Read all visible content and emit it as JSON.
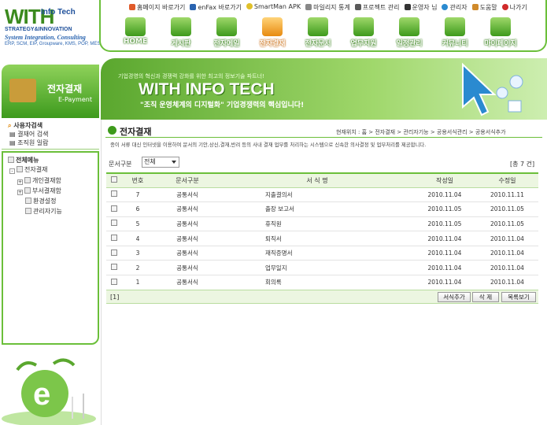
{
  "logo": {
    "line1": "WITH",
    "line2": "Info Tech",
    "line3": "STRATEGY&INNOVATION",
    "line4": "System Integration, Consulting",
    "line5": "ERP, SCM, EIP, Groupware, KMS, POP, MES"
  },
  "top_links": [
    "홈페이지 바로가기",
    "enFax 바로가기",
    "SmartMan APK",
    "마일리지 통계",
    "프로젝트 관리",
    "운영자 님",
    "관리자",
    "도움말",
    "나가기"
  ],
  "nav": [
    {
      "label": "HOME",
      "active": false
    },
    {
      "label": "게시판",
      "active": false
    },
    {
      "label": "전자메일",
      "active": false
    },
    {
      "label": "전자결재",
      "active": true
    },
    {
      "label": "전자문서",
      "active": false
    },
    {
      "label": "업무지원",
      "active": false
    },
    {
      "label": "일정관리",
      "active": false
    },
    {
      "label": "커뮤니티",
      "active": false
    },
    {
      "label": "마이페이지",
      "active": false
    }
  ],
  "banner": {
    "tagline": "기업경영의 혁신과 경쟁력 강화를 위한 최고의 정보기술 파트너!",
    "title": "WITH INFO TECH",
    "slogan": "\"조직 운영체계의 디지털화\" 기업경쟁력의 핵심입니다!"
  },
  "left": {
    "title": "전자결재",
    "subtitle": "E-Payment",
    "search_header": "사용자검색",
    "search_items": [
      "결재어 검색",
      "조직원 일람"
    ],
    "menu_header": "전체메뉴",
    "tree": [
      {
        "label": "전자결재",
        "level": 0,
        "toggle": "-"
      },
      {
        "label": "개인결재함",
        "level": 1,
        "toggle": "+"
      },
      {
        "label": "부서결재함",
        "level": 1,
        "toggle": "+"
      },
      {
        "label": "환경설정",
        "level": 2,
        "toggle": ""
      },
      {
        "label": "관리자기능",
        "level": 2,
        "toggle": ""
      }
    ]
  },
  "page": {
    "title": "전자결재",
    "breadcrumb": "현재위치 : 홈 > 전자결재 > 관리자기능 > 공용서식관리 > 공용서식추가",
    "description": "종이 서류 대신 인터넷을 이용하여 문서의 기안,상신,결재,반려 등의 사내 결재 업무를 처리하는 시스템으로 신속한 의사결정 및 업무처리를 제공합니다."
  },
  "filter": {
    "label": "문서구분",
    "selected": "전체"
  },
  "total": "[총 7 건]",
  "table": {
    "headers": [
      "번호",
      "문서구분",
      "서 식 명",
      "작성일",
      "수정일"
    ],
    "rows": [
      {
        "no": "7",
        "type": "공통서식",
        "name": "지출결의서",
        "created": "2010.11.04",
        "modified": "2010.11.11"
      },
      {
        "no": "6",
        "type": "공통서식",
        "name": "출장 보고서",
        "created": "2010.11.05",
        "modified": "2010.11.05"
      },
      {
        "no": "5",
        "type": "공통서식",
        "name": "휴직원",
        "created": "2010.11.05",
        "modified": "2010.11.05"
      },
      {
        "no": "4",
        "type": "공통서식",
        "name": "퇴직서",
        "created": "2010.11.04",
        "modified": "2010.11.04"
      },
      {
        "no": "3",
        "type": "공통서식",
        "name": "재직증명서",
        "created": "2010.11.04",
        "modified": "2010.11.04"
      },
      {
        "no": "2",
        "type": "공통서식",
        "name": "업무일지",
        "created": "2010.11.04",
        "modified": "2010.11.04"
      },
      {
        "no": "1",
        "type": "공통서식",
        "name": "회의록",
        "created": "2010.11.04",
        "modified": "2010.11.04"
      }
    ]
  },
  "pager": "[1]",
  "buttons": {
    "add": "서식추가",
    "delete": "삭 제",
    "list": "목록보기"
  },
  "colors": {
    "accent": "#6bbf3a",
    "accent_dark": "#3e9a1c",
    "active_nav": "#e88a10"
  }
}
